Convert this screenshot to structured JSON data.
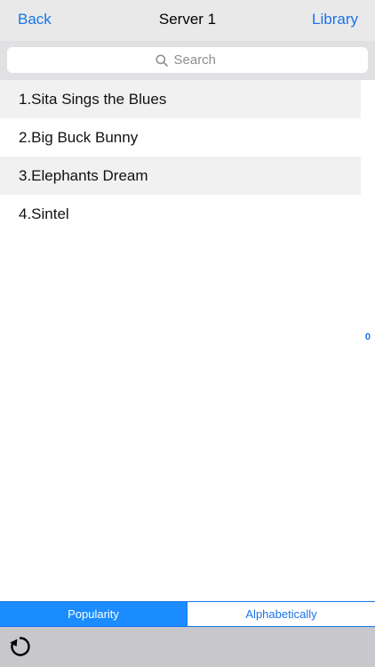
{
  "navbar": {
    "back_label": "Back",
    "title": "Server 1",
    "library_label": "Library"
  },
  "search": {
    "placeholder": "Search",
    "icon": "search-icon"
  },
  "list": {
    "items": [
      {
        "label": "1.Sita Sings the Blues"
      },
      {
        "label": "2.Big Buck Bunny"
      },
      {
        "label": "3.Elephants Dream"
      },
      {
        "label": "4.Sintel"
      }
    ]
  },
  "index_badge": "0",
  "sort": {
    "options": [
      {
        "label": "Popularity",
        "selected": true
      },
      {
        "label": "Alphabetically",
        "selected": false
      }
    ]
  },
  "toolbar": {
    "refresh_icon": "refresh-icon"
  },
  "colors": {
    "accent": "#1a73e8",
    "selected_segment": "#1a8cff",
    "navbar_bg": "#e9e9ea",
    "toolbar_bg": "#c7c7cc"
  }
}
